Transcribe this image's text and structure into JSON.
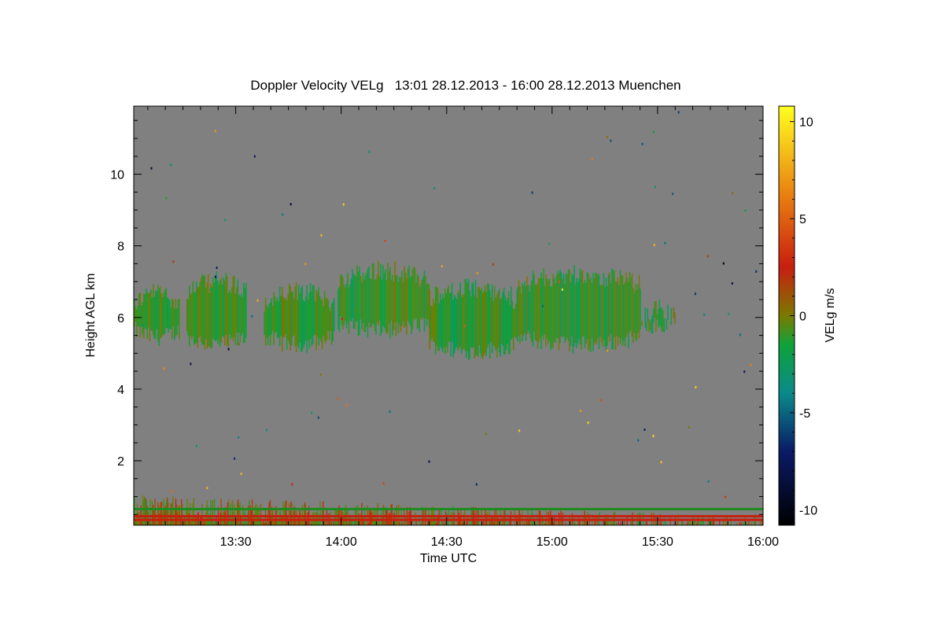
{
  "chart_data": {
    "type": "heatmap",
    "title": "Doppler Velocity VELg   13:01 28.12.2013 - 16:00 28.12.2013 Muenchen",
    "xlabel": "Time UTC",
    "ylabel": "Height AGL km",
    "colorbar_label": "VELg m/s",
    "x_range": [
      "13:01",
      "16:00"
    ],
    "x_ticks": [
      "13:30",
      "14:00",
      "14:30",
      "15:00",
      "15:30",
      "16:00"
    ],
    "ylim": [
      0.2,
      11.9
    ],
    "y_ticks": [
      2,
      4,
      6,
      8,
      10
    ],
    "colorbar_range": [
      -10.8,
      10.8
    ],
    "colorbar_ticks": [
      10,
      5,
      0,
      -5,
      -10
    ],
    "grid": false,
    "background_color": "#808080",
    "colormap": [
      {
        "value": -10.8,
        "color": "#000000"
      },
      {
        "value": -7.0,
        "color": "#0a1a66"
      },
      {
        "value": -4.0,
        "color": "#0a8a8a"
      },
      {
        "value": -1.5,
        "color": "#0fa23a"
      },
      {
        "value": 0.0,
        "color": "#7a7a00"
      },
      {
        "value": 2.5,
        "color": "#c81e10"
      },
      {
        "value": 6.0,
        "color": "#e87a10"
      },
      {
        "value": 10.8,
        "color": "#ffff20"
      }
    ],
    "features": [
      {
        "name": "cloud layer",
        "time_start": "13:01",
        "time_end": "15:36",
        "height_base_km": 5.2,
        "height_top_km": 7.3,
        "velocity_mps": -1
      },
      {
        "name": "boundary layer",
        "time_start": "13:01",
        "time_end": "16:00",
        "height_base_km": 0.2,
        "height_top_km": 1.0,
        "velocity_mps": 0.5
      }
    ],
    "cloud_segments": [
      {
        "t0": "13:01",
        "t1": "13:14",
        "base": 5.2,
        "top": 7.0
      },
      {
        "t0": "13:16",
        "t1": "13:33",
        "base": 5.0,
        "top": 7.3
      },
      {
        "t0": "13:38",
        "t1": "13:58",
        "base": 5.0,
        "top": 7.0
      },
      {
        "t0": "13:59",
        "t1": "14:25",
        "base": 5.4,
        "top": 7.6
      },
      {
        "t0": "14:25",
        "t1": "14:50",
        "base": 4.8,
        "top": 7.1
      },
      {
        "t0": "14:50",
        "t1": "15:25",
        "base": 5.0,
        "top": 7.5
      },
      {
        "t0": "15:25",
        "t1": "15:36",
        "base": 5.5,
        "top": 6.5
      }
    ],
    "layer_lines": [
      {
        "height_km": 0.65,
        "color": "#1f8a1f"
      },
      {
        "height_km": 0.45,
        "color": "#c81e10"
      },
      {
        "height_km": 0.35,
        "color": "#c81e10"
      }
    ]
  }
}
